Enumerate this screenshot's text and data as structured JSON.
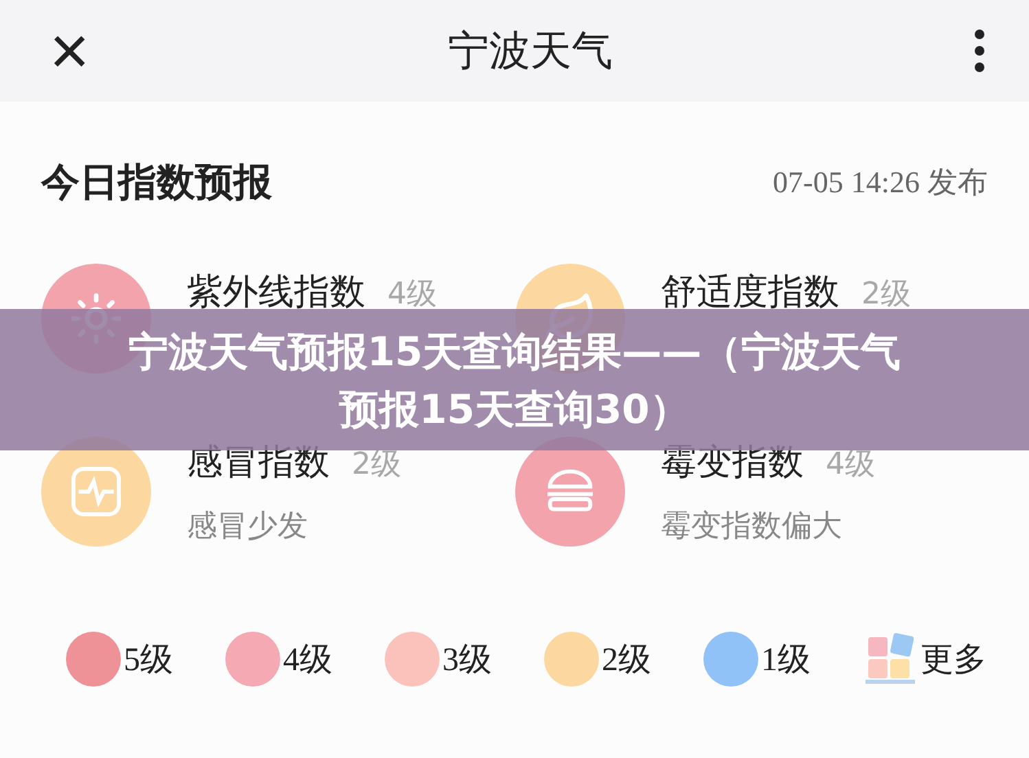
{
  "header": {
    "close": "×",
    "title": "宁波天气"
  },
  "card": {
    "title": "今日指数预报",
    "published": "07-05 14:26 发布"
  },
  "indices": [
    {
      "name": "紫外线指数",
      "level": "4级",
      "color": "#f3a3ab"
    },
    {
      "name": "舒适度指数",
      "level": "2级",
      "color": "#fcd79f"
    },
    {
      "name": "感冒指数",
      "level": "2级",
      "desc": "感冒少发",
      "color": "#fcd79f"
    },
    {
      "name": "霉变指数",
      "level": "4级",
      "desc": "霉变指数偏大",
      "color": "#f3a3ab"
    }
  ],
  "legend": [
    {
      "label": "5级",
      "color": "#ee9297"
    },
    {
      "label": "4级",
      "color": "#f5aab3"
    },
    {
      "label": "3级",
      "color": "#fbc2bc"
    },
    {
      "label": "2级",
      "color": "#fcd79f"
    },
    {
      "label": "1级",
      "color": "#90c2f7"
    }
  ],
  "more": "更多",
  "banner": {
    "lines": [
      "宁波天气预报15天查询结果——（宁波天气",
      "预报15天查询30）"
    ]
  }
}
